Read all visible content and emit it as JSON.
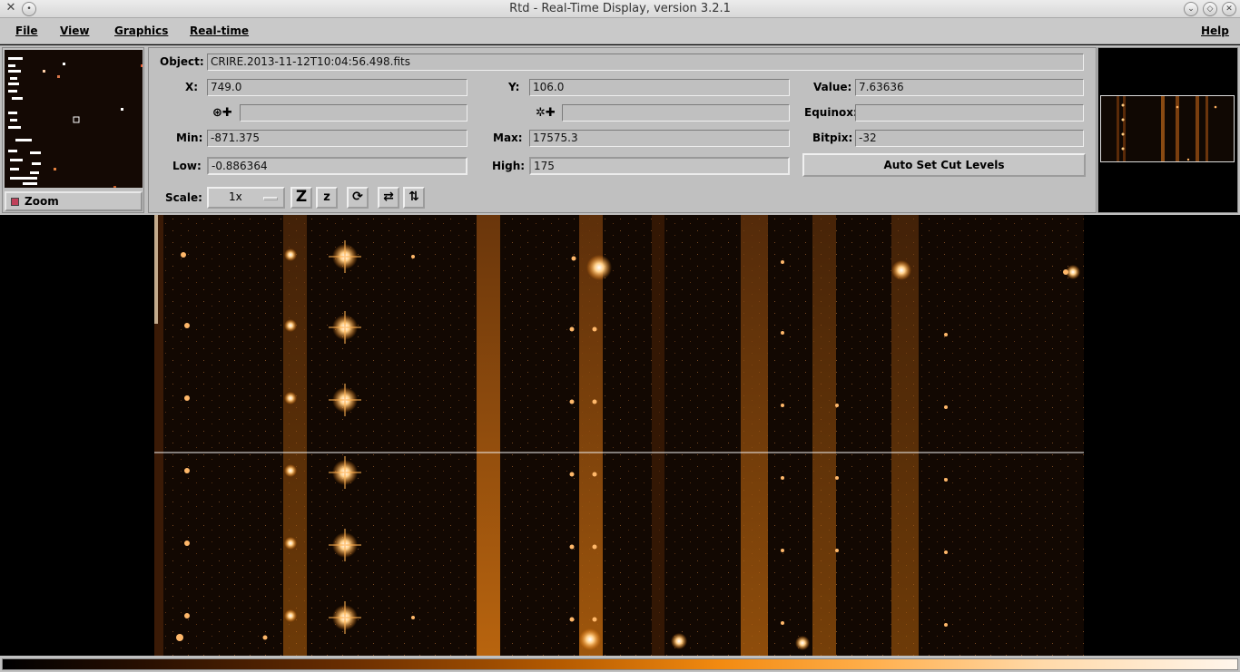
{
  "window": {
    "title": "Rtd - Real-Time Display, version 3.2.1"
  },
  "menu": {
    "file": "File",
    "view": "View",
    "graphics": "Graphics",
    "realtime": "Real-time",
    "help": "Help"
  },
  "zoom": {
    "label": "Zoom"
  },
  "info": {
    "object_label": "Object:",
    "object_value": "CRIRE.2013-11-12T10:04:56.498.fits",
    "x_label": "X:",
    "x_value": "749.0",
    "y_label": "Y:",
    "y_value": "106.0",
    "value_label": "Value:",
    "value_value": "7.63636",
    "equinox_label": "Equinox:",
    "equinox_value": "",
    "min_label": "Min:",
    "min_value": "-871.375",
    "max_label": "Max:",
    "max_value": "17575.3",
    "bitpix_label": "Bitpix:",
    "bitpix_value": "-32",
    "low_label": "Low:",
    "low_value": "-0.886364",
    "high_label": "High:",
    "high_value": "175",
    "auto_cut_label": "Auto Set Cut Levels",
    "scale_label": "Scale:",
    "scale_value": "1x",
    "zoom_in_glyph": "Z",
    "zoom_out_glyph": "z"
  },
  "colors": {
    "panel": "#c0c0c0",
    "image_bg": "#120802",
    "accent": "#ff9a2a"
  }
}
